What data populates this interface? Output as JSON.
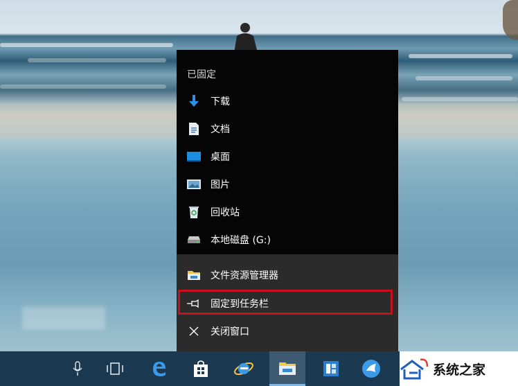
{
  "jump_list": {
    "header": "已固定",
    "pinned": [
      {
        "label": "下载",
        "icon": "download-icon"
      },
      {
        "label": "文档",
        "icon": "document-icon"
      },
      {
        "label": "桌面",
        "icon": "desktop-icon"
      },
      {
        "label": "图片",
        "icon": "pictures-icon"
      },
      {
        "label": "回收站",
        "icon": "recycle-bin-icon"
      },
      {
        "label": "本地磁盘 (G:)",
        "icon": "drive-icon"
      }
    ],
    "actions": [
      {
        "label": "文件资源管理器",
        "icon": "file-explorer-icon"
      },
      {
        "label": "固定到任务栏",
        "icon": "pin-icon"
      },
      {
        "label": "关闭窗口",
        "icon": "close-icon"
      }
    ]
  },
  "taskbar": {
    "items": [
      "microphone-icon",
      "task-view-icon",
      "edge-icon",
      "store-icon",
      "ie-icon",
      "file-explorer-icon",
      "app-icon",
      "bird-app-icon"
    ],
    "active": "file-explorer-icon"
  },
  "watermark": {
    "text": "系统之家"
  },
  "colors": {
    "highlight": "#c8111c",
    "taskbar": "#1b3a52",
    "menu": "#050505"
  }
}
